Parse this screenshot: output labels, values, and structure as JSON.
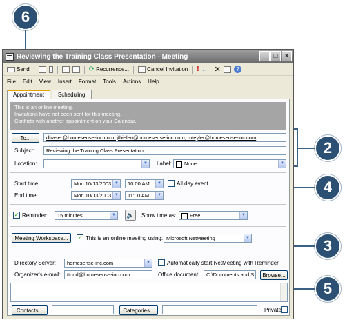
{
  "callouts": [
    "6",
    "2",
    "4",
    "3",
    "5"
  ],
  "window": {
    "title": "Reviewing the Training Class Presentation - Meeting",
    "controls": [
      "_",
      "□",
      "×"
    ]
  },
  "toolbar": {
    "send": "Send",
    "recurrence": "Recurrence...",
    "cancel_invitation": "Cancel Invitation"
  },
  "menu": [
    "File",
    "Edit",
    "View",
    "Insert",
    "Format",
    "Tools",
    "Actions",
    "Help"
  ],
  "tabs": [
    "Appointment",
    "Scheduling"
  ],
  "info": [
    "This is an online meeting.",
    "Invitations have not been sent for this meeting.",
    "Conflicts with another appointment on your Calendar."
  ],
  "form": {
    "to_button": "To...",
    "to_value": "dfraser@homesense-inc.com; jthielen@homesense-inc.com; mteyler@homesense-inc.com",
    "subject_label": "Subject:",
    "subject_value": "Reviewing the Training Class Presentation",
    "location_label": "Location:",
    "location_value": "",
    "label_label": "Label:",
    "label_value": "None",
    "start_label": "Start time:",
    "start_date": "Mon 10/13/2003",
    "start_time": "10:00 AM",
    "end_label": "End time:",
    "end_date": "Mon 10/13/2003",
    "end_time": "11:00 AM",
    "all_day": "All day event",
    "reminder_label": "Reminder:",
    "reminder_value": "15 minutes",
    "showtime_label": "Show time as:",
    "showtime_value": "Free",
    "workspace_button": "Meeting Workspace...",
    "online_label": "This is an online meeting using:",
    "online_value": "Microsoft NetMeeting",
    "dirserver_label": "Directory Server:",
    "dirserver_value": "homesense-inc.com",
    "auto_start": "Automatically start NetMeeting with Reminder",
    "org_email_label": "Organizer's e-mail:",
    "org_email_value": "ttodd@homesense-inc.com",
    "office_doc_label": "Office document:",
    "office_doc_value": "C:\\Documents and S",
    "browse_button": "Browse...",
    "contacts_button": "Contacts...",
    "categories_button": "Categories...",
    "private_label": "Private"
  }
}
